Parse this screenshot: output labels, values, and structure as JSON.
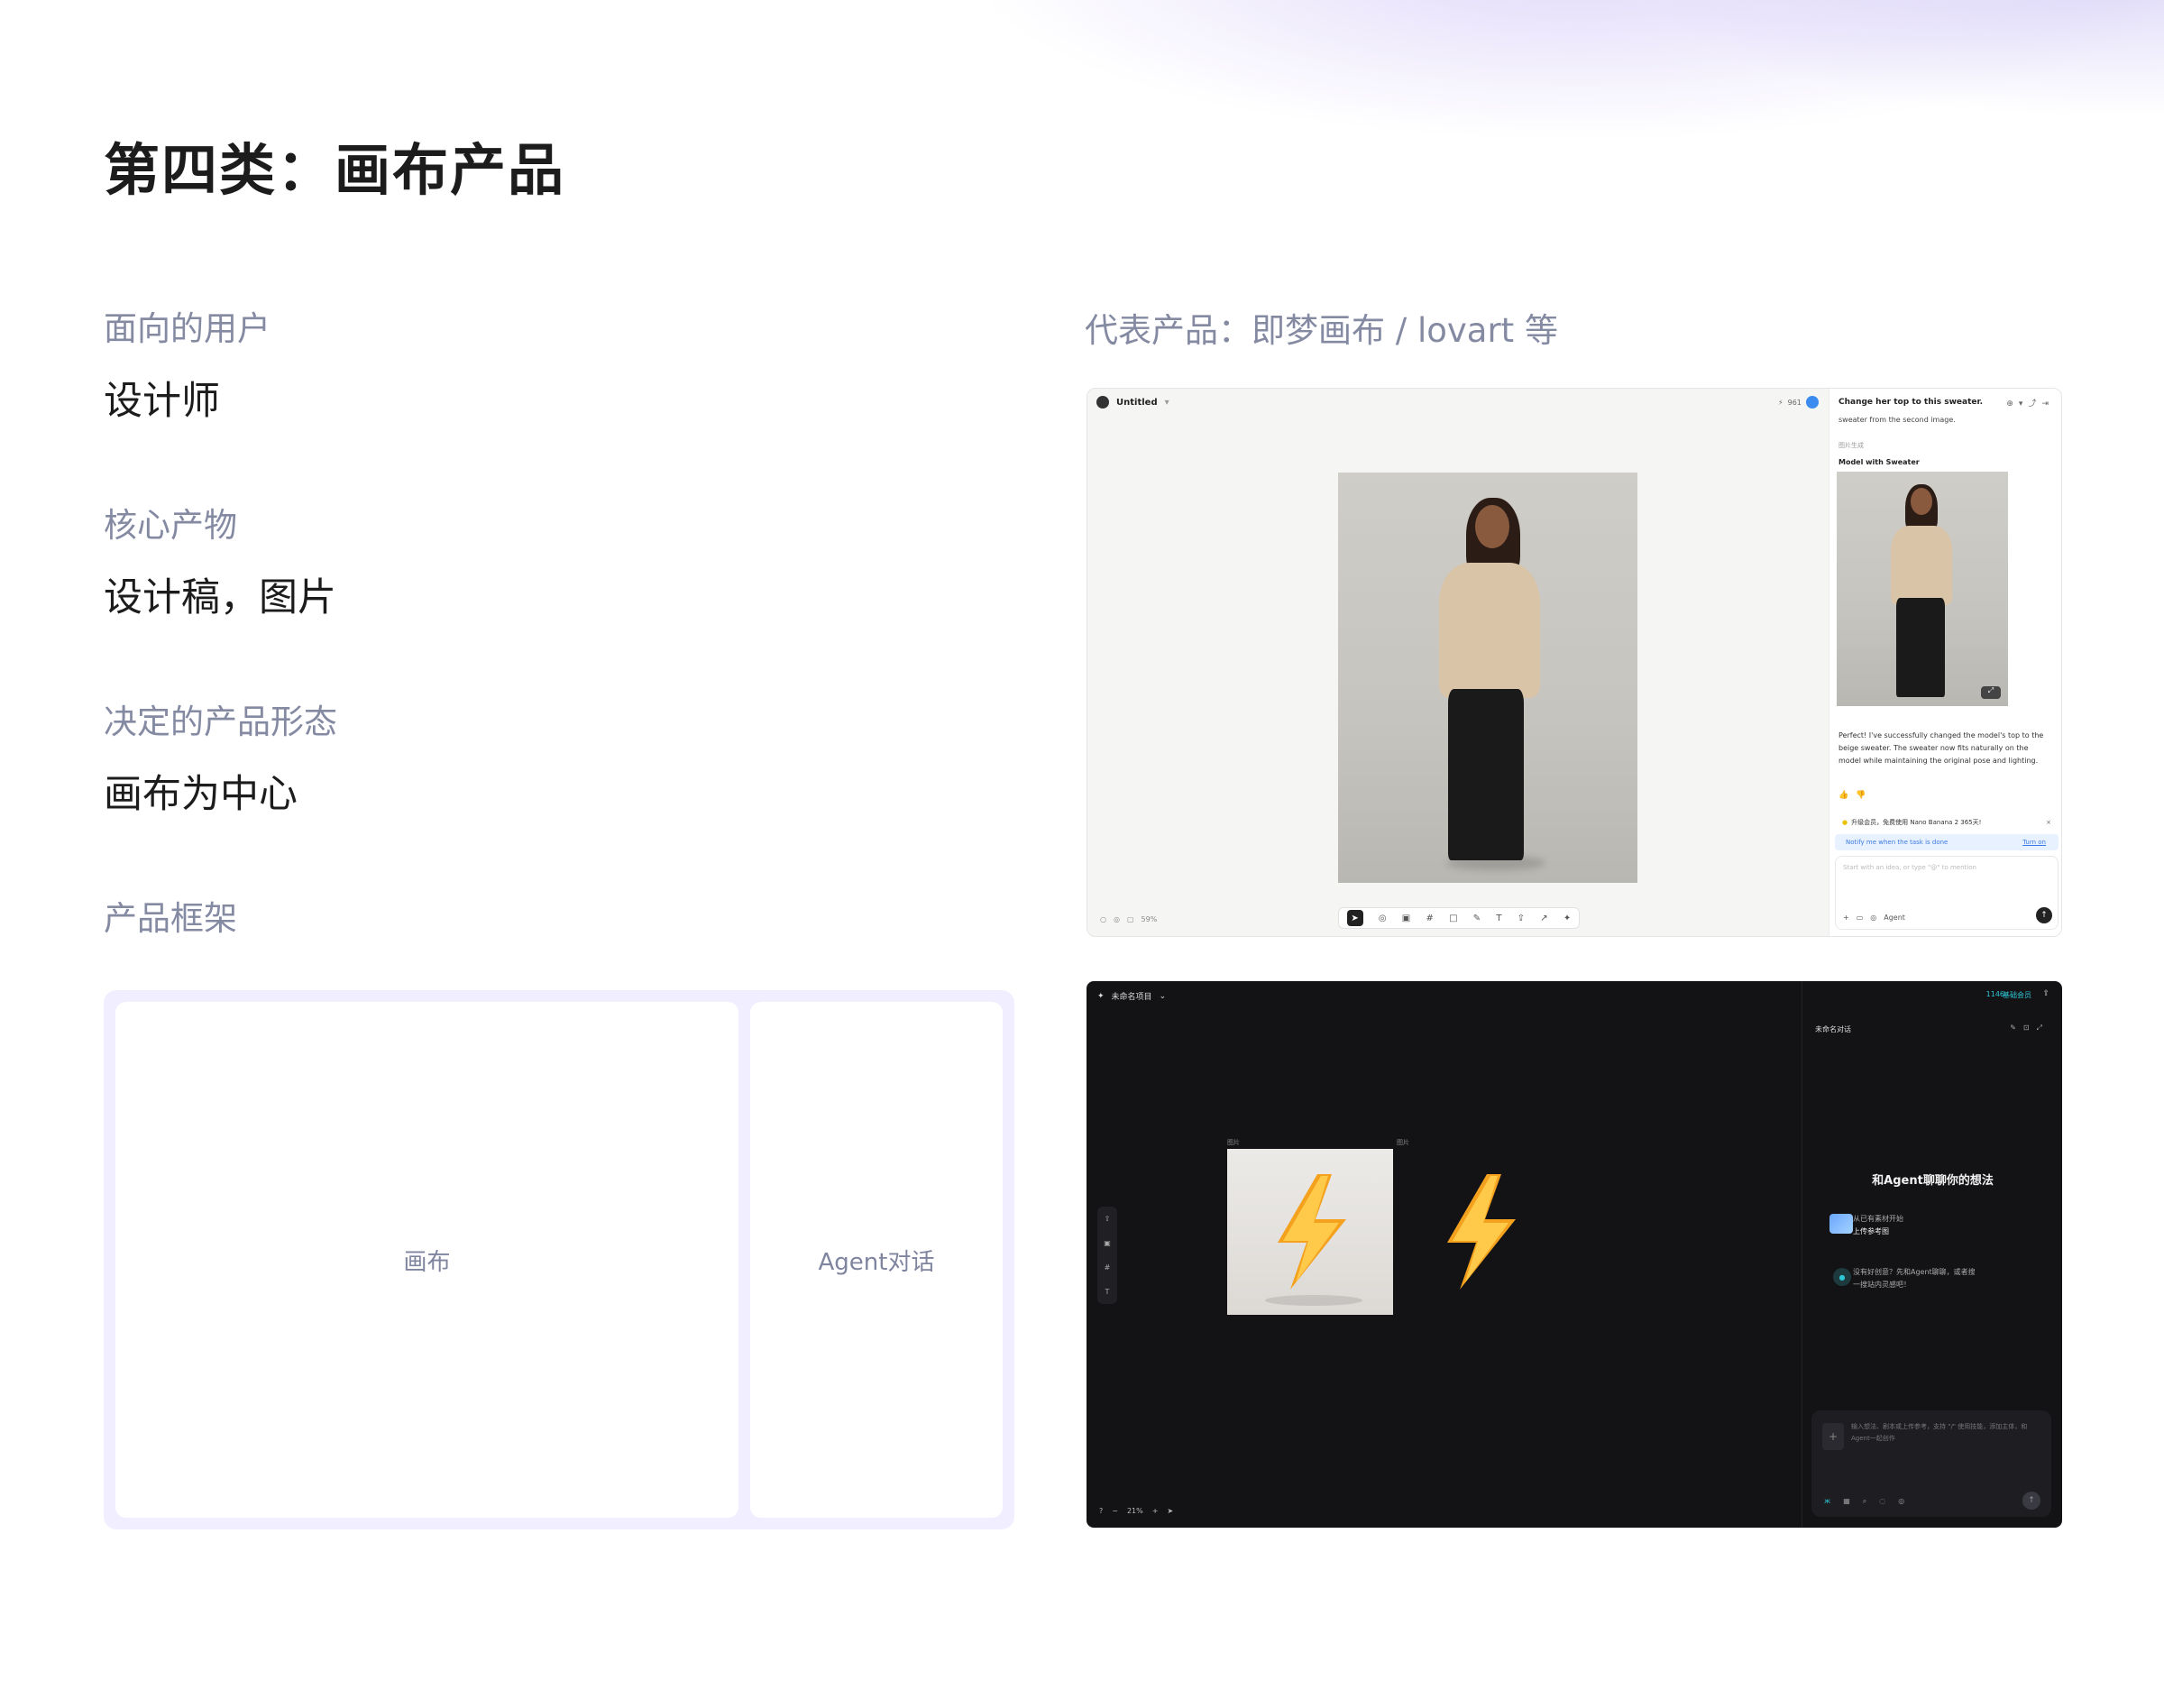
{
  "page": {
    "title": "第四类：画布产品",
    "sections": [
      {
        "label": "面向的用户",
        "value": "设计师"
      },
      {
        "label": "核心产物",
        "value": "设计稿，图片"
      },
      {
        "label": "决定的产品形态",
        "value": "画布为中心"
      },
      {
        "label": "产品框架",
        "value": ""
      }
    ],
    "representative_title": "代表产品：即梦画布 / lovart 等"
  },
  "framework": {
    "canvas_label": "画布",
    "agent_label": "Agent对话"
  },
  "shot1": {
    "doc_title": "Untitled",
    "credits": "961",
    "zoom": "59%",
    "toolbar_icons": [
      "pointer-icon",
      "circle-icon",
      "image-icon",
      "frame-icon",
      "square-icon",
      "pen-icon",
      "text-icon",
      "upload-icon",
      "export-icon",
      "sticker-icon"
    ],
    "chat": {
      "title": "Change her top to this sweater.",
      "subtitle": "sweater from the second image.",
      "tag": "图片生成",
      "result_title": "Model with Sweater",
      "result_text": "Perfect! I've successfully changed the model's top to the beige sweater. The sweater now fits naturally on the model while maintaining the original pose and lighting.",
      "promo": "升级会员，免费使用 Nano Banana 2 365天!",
      "notify": "Notify me when the task is done",
      "notify_action": "Turn on",
      "input_placeholder": "Start with an idea, or type \"@\" to mention",
      "mode": "Agent"
    }
  },
  "shot2": {
    "project_title": "未命名项目",
    "credits": "1146",
    "member": "基础会员",
    "image_label_1": "图片",
    "image_label_2": "图片",
    "zoom": "21%",
    "chat": {
      "title": "未命名对话",
      "welcome": "和Agent聊聊你的想法",
      "opt1_title": "从已有素材开始",
      "opt1_action": "上传参考图",
      "opt2_text": "没有好创意？先和Agent聊聊，或者搜一搜站内灵感吧！",
      "input_placeholder": "输入想法、剧本或上传参考，支持 \"/\" 使用技能，添加主体，和Agent一起创作"
    }
  }
}
